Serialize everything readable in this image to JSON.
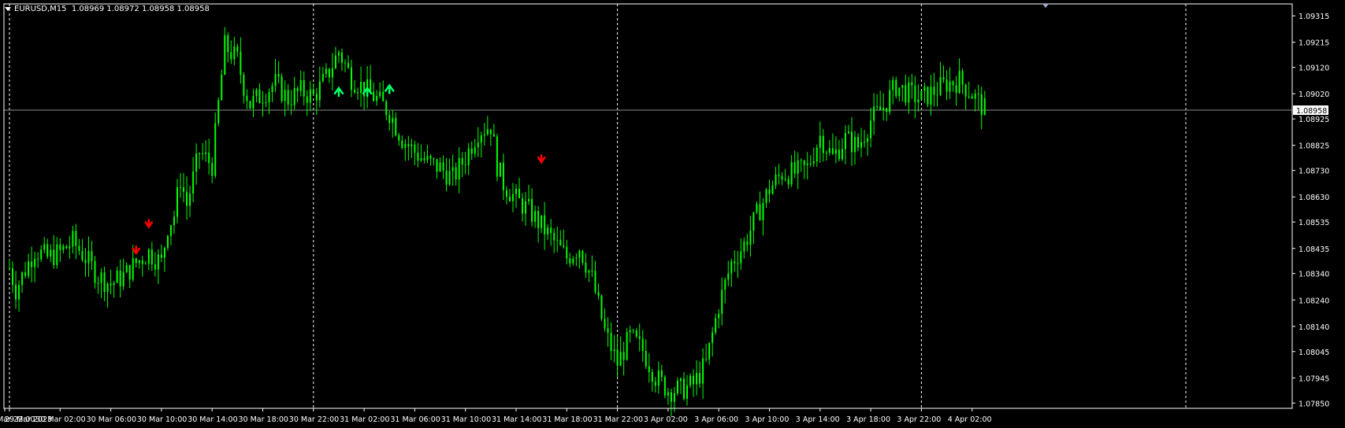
{
  "header": {
    "symbol": "EURUSD,M15",
    "open": "1.08969",
    "high": "1.08972",
    "low": "1.08958",
    "close": "1.08958"
  },
  "colors": {
    "background": "#000000",
    "candle": "#00ff00",
    "frame": "#ffffff",
    "grid": "#ffffff",
    "price_line": "#8c8c8c",
    "arrow_down": "#ff0000",
    "arrow_up": "#00ff66",
    "price_label_bg": "#ffffff",
    "price_label_text": "#000000"
  },
  "chart_data": {
    "type": "candlestick",
    "symbol": "EURUSD",
    "timeframe": "M15",
    "ylim": [
      1.0783,
      1.0936
    ],
    "y_ticks": [
      "1.09315",
      "1.09215",
      "1.09120",
      "1.09020",
      "1.08925",
      "1.08825",
      "1.08730",
      "1.08630",
      "1.08535",
      "1.08435",
      "1.08340",
      "1.08240",
      "1.08140",
      "1.08045",
      "1.07945",
      "1.07850"
    ],
    "x_ticks": [
      "29 Mar 2023",
      "29 Mar 22:00",
      "30 Mar 02:00",
      "30 Mar 06:00",
      "30 Mar 10:00",
      "30 Mar 14:00",
      "30 Mar 18:00",
      "30 Mar 22:00",
      "31 Mar 02:00",
      "31 Mar 06:00",
      "31 Mar 10:00",
      "31 Mar 14:00",
      "31 Mar 18:00",
      "31 Mar 22:00",
      "3 Apr 02:00",
      "3 Apr 06:00",
      "3 Apr 10:00",
      "3 Apr 14:00",
      "3 Apr 18:00",
      "3 Apr 22:00",
      "4 Apr 02:00"
    ],
    "day_separators": [
      "29 Mar 22:00",
      "30 Mar 22:00",
      "31 Mar 22:00",
      "3 Apr 22:00"
    ],
    "current_price": "1.08958",
    "close_path": [
      [
        0,
        1.0836
      ],
      [
        0.5,
        1.0828
      ],
      [
        1,
        1.0833
      ],
      [
        2,
        1.0843
      ],
      [
        3,
        1.084
      ],
      [
        4,
        1.0842
      ],
      [
        5,
        1.0846
      ],
      [
        6,
        1.084
      ],
      [
        7,
        1.0833
      ],
      [
        8,
        1.083
      ],
      [
        9,
        1.0833
      ],
      [
        10,
        1.0838
      ],
      [
        11,
        1.0842
      ],
      [
        12,
        1.0838
      ],
      [
        12.5,
        1.0852
      ],
      [
        13,
        1.0856
      ],
      [
        13.5,
        1.087
      ],
      [
        14,
        1.086
      ],
      [
        15,
        1.088
      ],
      [
        16,
        1.0875
      ],
      [
        16.5,
        1.0898
      ],
      [
        17,
        1.092
      ],
      [
        18,
        1.0915
      ],
      [
        18.5,
        1.0905
      ],
      [
        19,
        1.0898
      ],
      [
        20,
        1.0902
      ],
      [
        21,
        1.0906
      ],
      [
        22,
        1.09
      ],
      [
        23,
        1.0903
      ],
      [
        24,
        1.0901
      ],
      [
        25,
        1.0908
      ],
      [
        26,
        1.0918
      ],
      [
        27,
        1.0908
      ],
      [
        28,
        1.0904
      ],
      [
        29,
        1.09
      ],
      [
        30,
        1.0895
      ],
      [
        31,
        1.0885
      ],
      [
        32,
        1.088
      ],
      [
        33,
        1.0876
      ],
      [
        34,
        1.0874
      ],
      [
        35,
        1.087
      ],
      [
        36,
        1.0878
      ],
      [
        37,
        1.0888
      ],
      [
        38,
        1.089
      ],
      [
        38.5,
        1.0875
      ],
      [
        39,
        1.0868
      ],
      [
        40,
        1.0862
      ],
      [
        41,
        1.0858
      ],
      [
        42,
        1.0852
      ],
      [
        43,
        1.0846
      ],
      [
        44,
        1.084
      ],
      [
        45,
        1.0844
      ],
      [
        46,
        1.0832
      ],
      [
        47,
        1.0812
      ],
      [
        48,
        1.08
      ],
      [
        49,
        1.081
      ],
      [
        50,
        1.0805
      ],
      [
        51,
        1.0795
      ],
      [
        52,
        1.079
      ],
      [
        53,
        1.079
      ],
      [
        54,
        1.0792
      ],
      [
        55,
        1.08
      ],
      [
        56,
        1.0822
      ],
      [
        57,
        1.0838
      ],
      [
        58,
        1.0845
      ],
      [
        59,
        1.0856
      ],
      [
        60,
        1.0866
      ],
      [
        61,
        1.0872
      ],
      [
        62,
        1.0872
      ],
      [
        63,
        1.0874
      ],
      [
        64,
        1.0886
      ],
      [
        65,
        1.0878
      ],
      [
        66,
        1.0885
      ],
      [
        67,
        1.0882
      ],
      [
        68,
        1.0892
      ],
      [
        69,
        1.0897
      ],
      [
        70,
        1.0905
      ],
      [
        71,
        1.0902
      ],
      [
        72,
        1.09
      ],
      [
        73,
        1.0903
      ],
      [
        74,
        1.0906
      ],
      [
        75,
        1.0907
      ],
      [
        76,
        1.0902
      ],
      [
        77,
        1.0896
      ]
    ],
    "arrows": [
      {
        "type": "down",
        "time": "30 Mar 08:00",
        "price": 1.08425
      },
      {
        "type": "down",
        "time": "30 Mar 09:00",
        "price": 1.08525
      },
      {
        "type": "down",
        "time": "31 Mar 16:00",
        "price": 1.0877
      },
      {
        "type": "up",
        "time": "31 Mar 00:00",
        "price": 1.0903
      },
      {
        "type": "up",
        "time": "31 Mar 02:15",
        "price": 1.0903
      },
      {
        "type": "up",
        "time": "31 Mar 04:00",
        "price": 1.0904
      }
    ]
  }
}
